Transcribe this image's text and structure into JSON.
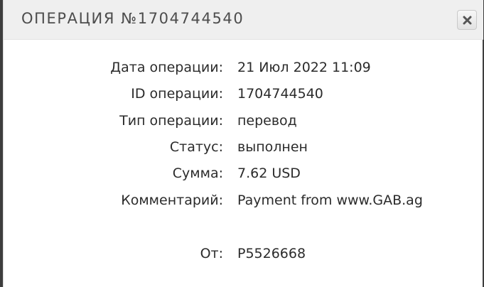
{
  "header": {
    "title": "ОПЕРАЦИЯ №1704744540",
    "close_icon": "close-x-icon"
  },
  "details": {
    "rows": [
      {
        "label": "Дата операции:",
        "value": "21 Июл 2022 11:09"
      },
      {
        "label": "ID операции:",
        "value": "1704744540"
      },
      {
        "label": "Тип операции:",
        "value": "перевод"
      },
      {
        "label": "Статус:",
        "value": "выполнен"
      },
      {
        "label": "Сумма:",
        "value": "7.62 USD"
      },
      {
        "label": "Комментарий:",
        "value": "Payment from www.GAB.ag"
      },
      {
        "label": "От:",
        "value": "P5526668"
      }
    ]
  },
  "colors": {
    "header_bg": "#efefef",
    "text": "#2b2b2b",
    "title_text": "#4d4d4d"
  }
}
